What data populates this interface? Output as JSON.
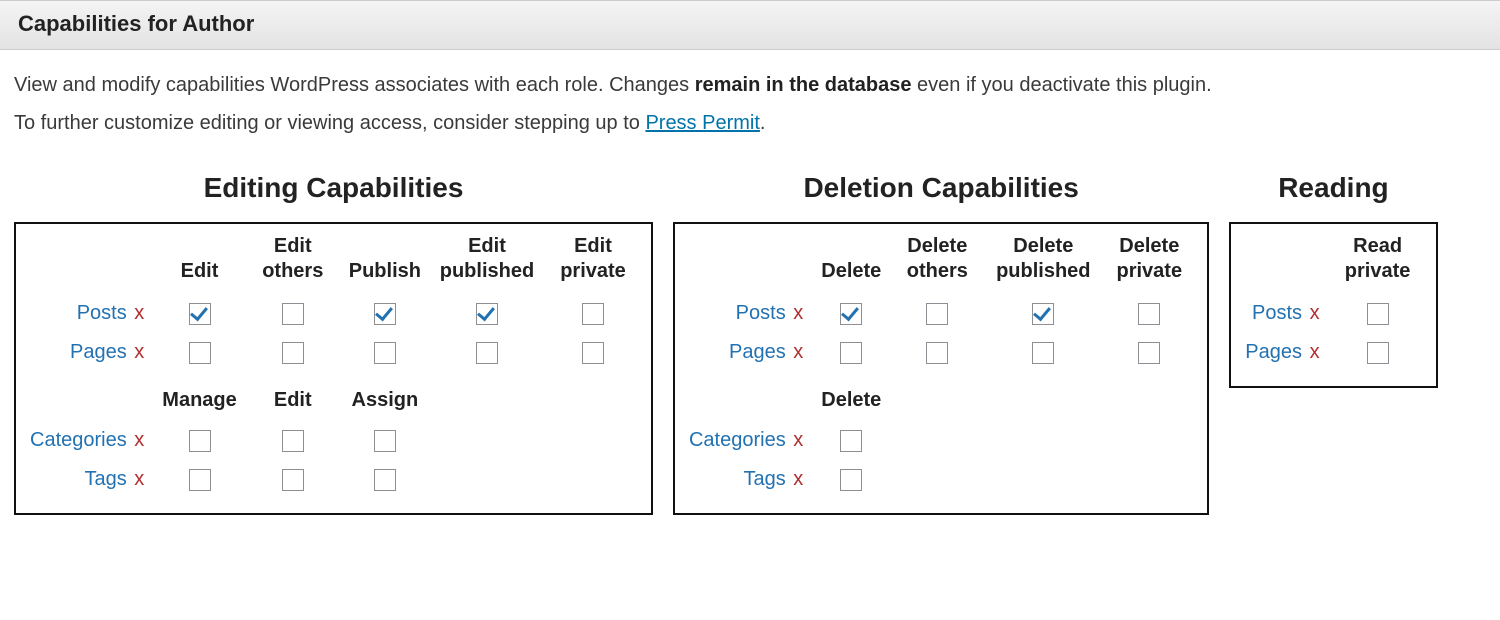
{
  "header": {
    "title": "Capabilities for Author"
  },
  "intro": {
    "line1_a": "View and modify capabilities WordPress associates with each role. Changes ",
    "line1_b": "remain in the database",
    "line1_c": " even if you deactivate this plugin.",
    "line2_a": "To further customize editing or viewing access, consider stepping up to ",
    "line2_link": "Press Permit",
    "line2_b": "."
  },
  "labels": {
    "x": "x",
    "rows": {
      "posts": "Posts",
      "pages": "Pages",
      "categories": "Categories",
      "tags": "Tags"
    }
  },
  "panels": {
    "editing": {
      "title": "Editing Capabilities",
      "cols": [
        "Edit",
        "Edit others",
        "Publish",
        "Edit published",
        "Edit private"
      ],
      "posts": [
        true,
        false,
        true,
        true,
        false
      ],
      "pages": [
        false,
        false,
        false,
        false,
        false
      ],
      "tax_cols": [
        "Manage",
        "Edit",
        "Assign"
      ],
      "categories": [
        false,
        false,
        false
      ],
      "tags": [
        false,
        false,
        false
      ]
    },
    "deletion": {
      "title": "Deletion Capabilities",
      "cols": [
        "Delete",
        "Delete others",
        "Delete published",
        "Delete private"
      ],
      "posts": [
        true,
        false,
        true,
        false
      ],
      "pages": [
        false,
        false,
        false,
        false
      ],
      "tax_cols": [
        "Delete"
      ],
      "categories": [
        false
      ],
      "tags": [
        false
      ]
    },
    "reading": {
      "title": "Reading",
      "cols": [
        "Read private"
      ],
      "posts": [
        false
      ],
      "pages": [
        false
      ]
    }
  }
}
